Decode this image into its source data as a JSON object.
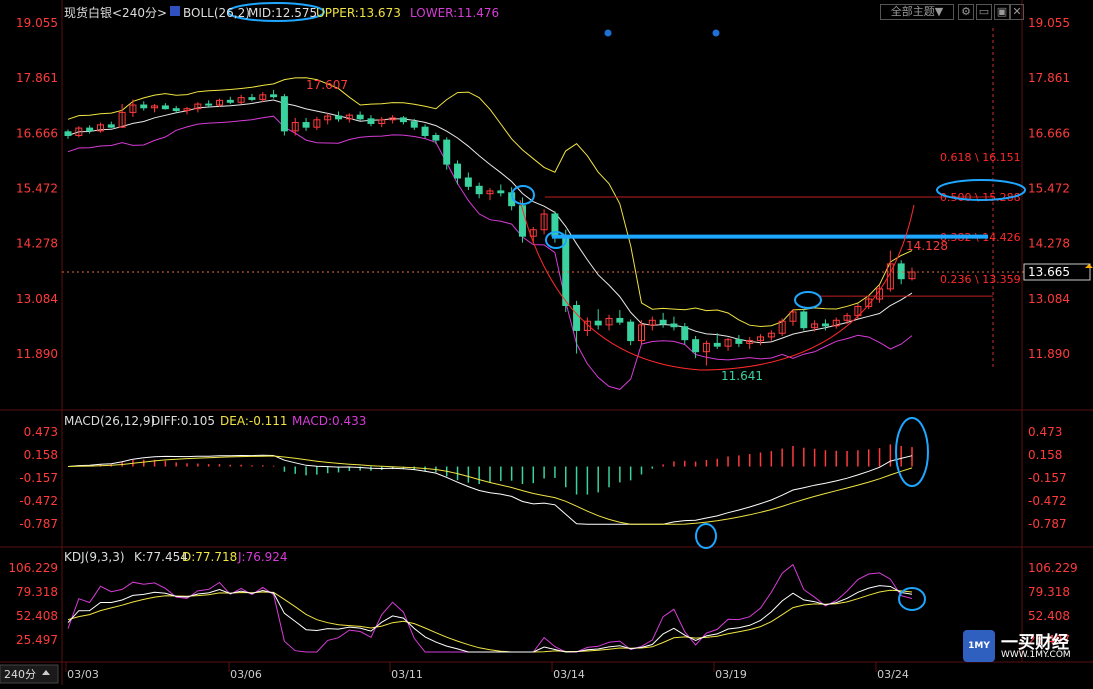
{
  "header": {
    "symbol": "现货白银",
    "period": "<240分>",
    "indicator": "BOLL(26,2)",
    "mid": "MID:12.575",
    "upper": "UPPER:13.673",
    "lower": "LOWER:11.476",
    "theme_button": "全部主题",
    "theme_arrow": "▼"
  },
  "colors": {
    "up": "#ff3b3b",
    "down": "#3ad29f",
    "mid": "#e8e8e8",
    "upper": "#f0e442",
    "lower": "#d63cd6",
    "grid_text": "#ff3b3b",
    "blue_mark": "#1ea7ff",
    "kdj_k": "#ffffff",
    "kdj_d": "#f0e442",
    "kdj_j": "#d63cd6"
  },
  "price_axis": [
    "19.055",
    "17.861",
    "16.666",
    "15.472",
    "14.278",
    "13.084",
    "11.890"
  ],
  "price_current": "13.665",
  "annotations": {
    "high": "17.607",
    "low": "11.641",
    "recent_high": "14.128"
  },
  "fibo": [
    {
      "label": "0.618 \\ 16.151",
      "value": 16.151
    },
    {
      "label": "0.500 \\ 15.288",
      "value": 15.288
    },
    {
      "label": "0.382 \\ 14.426",
      "value": 14.426
    },
    {
      "label": "0.236 \\ 13.359",
      "value": 13.359
    }
  ],
  "macd": {
    "title": "MACD(26,12,9)",
    "diff": "DIFF:0.105",
    "dea": "DEA:-0.111",
    "macd": "MACD:0.433",
    "axis": [
      "0.473",
      "0.158",
      "-0.157",
      "-0.472",
      "-0.787"
    ]
  },
  "kdj": {
    "title": "KDJ(9,3,3)",
    "k": "K:77.454",
    "d": "D:77.718",
    "j": "J:76.924",
    "axis": [
      "106.229",
      "79.318",
      "52.408",
      "25.497"
    ]
  },
  "time_axis": {
    "period_label": "240分",
    "dates": [
      "03/03",
      "03/06",
      "03/11",
      "03/14",
      "03/19",
      "03/24"
    ]
  },
  "logo": {
    "badge": "1MY",
    "name": "一买财经",
    "url": "WWW.1MY.COM"
  },
  "chart_data": {
    "type": "candlestick",
    "ylim": [
      11.2,
      19.4
    ],
    "candles": [
      [
        16.7,
        16.75,
        16.55,
        16.62
      ],
      [
        16.62,
        16.82,
        16.58,
        16.78
      ],
      [
        16.78,
        16.84,
        16.66,
        16.72
      ],
      [
        16.72,
        16.9,
        16.68,
        16.85
      ],
      [
        16.85,
        16.92,
        16.78,
        16.8
      ],
      [
        16.8,
        17.3,
        16.78,
        17.12
      ],
      [
        17.12,
        17.4,
        17.02,
        17.28
      ],
      [
        17.28,
        17.36,
        17.16,
        17.22
      ],
      [
        17.22,
        17.3,
        17.12,
        17.26
      ],
      [
        17.26,
        17.32,
        17.18,
        17.2
      ],
      [
        17.2,
        17.26,
        17.1,
        17.16
      ],
      [
        17.16,
        17.24,
        17.08,
        17.2
      ],
      [
        17.2,
        17.34,
        17.12,
        17.3
      ],
      [
        17.3,
        17.38,
        17.22,
        17.28
      ],
      [
        17.28,
        17.42,
        17.24,
        17.38
      ],
      [
        17.38,
        17.46,
        17.3,
        17.34
      ],
      [
        17.34,
        17.5,
        17.3,
        17.44
      ],
      [
        17.44,
        17.52,
        17.36,
        17.4
      ],
      [
        17.4,
        17.56,
        17.34,
        17.5
      ],
      [
        17.5,
        17.607,
        17.42,
        17.46
      ],
      [
        17.46,
        17.52,
        16.62,
        16.72
      ],
      [
        16.72,
        17.0,
        16.62,
        16.9
      ],
      [
        16.9,
        17.0,
        16.72,
        16.8
      ],
      [
        16.8,
        17.02,
        16.74,
        16.96
      ],
      [
        16.96,
        17.1,
        16.86,
        17.04
      ],
      [
        17.04,
        17.14,
        16.92,
        16.98
      ],
      [
        16.98,
        17.1,
        16.9,
        17.06
      ],
      [
        17.06,
        17.14,
        16.94,
        16.98
      ],
      [
        16.98,
        17.06,
        16.82,
        16.88
      ],
      [
        16.88,
        17.02,
        16.8,
        16.96
      ],
      [
        16.96,
        17.06,
        16.88,
        17.0
      ],
      [
        17.0,
        17.04,
        16.86,
        16.92
      ],
      [
        16.92,
        16.98,
        16.74,
        16.8
      ],
      [
        16.8,
        16.86,
        16.56,
        16.62
      ],
      [
        16.62,
        16.68,
        16.44,
        16.52
      ],
      [
        16.52,
        16.58,
        15.88,
        16.0
      ],
      [
        16.0,
        16.08,
        15.56,
        15.7
      ],
      [
        15.7,
        15.82,
        15.44,
        15.52
      ],
      [
        15.52,
        15.6,
        15.26,
        15.36
      ],
      [
        15.36,
        15.48,
        15.22,
        15.42
      ],
      [
        15.42,
        15.56,
        15.3,
        15.38
      ],
      [
        15.38,
        15.5,
        15.0,
        15.1
      ],
      [
        15.1,
        15.28,
        14.3,
        14.44
      ],
      [
        14.44,
        14.64,
        14.3,
        14.58
      ],
      [
        14.58,
        15.02,
        14.48,
        14.92
      ],
      [
        14.92,
        14.98,
        14.3,
        14.44
      ],
      [
        14.44,
        14.58,
        12.8,
        12.94
      ],
      [
        12.94,
        13.04,
        11.9,
        12.4
      ],
      [
        12.4,
        12.68,
        12.28,
        12.6
      ],
      [
        12.6,
        12.86,
        12.42,
        12.52
      ],
      [
        12.52,
        12.74,
        12.4,
        12.66
      ],
      [
        12.66,
        12.84,
        12.52,
        12.58
      ],
      [
        12.58,
        12.64,
        12.08,
        12.18
      ],
      [
        12.18,
        12.62,
        12.1,
        12.52
      ],
      [
        12.52,
        12.7,
        12.4,
        12.62
      ],
      [
        12.62,
        12.78,
        12.46,
        12.54
      ],
      [
        12.54,
        12.7,
        12.4,
        12.48
      ],
      [
        12.48,
        12.56,
        12.1,
        12.2
      ],
      [
        12.2,
        12.28,
        11.8,
        11.94
      ],
      [
        11.94,
        12.18,
        11.641,
        12.12
      ],
      [
        12.12,
        12.34,
        12.0,
        12.06
      ],
      [
        12.06,
        12.24,
        11.96,
        12.2
      ],
      [
        12.2,
        12.3,
        12.04,
        12.12
      ],
      [
        12.12,
        12.26,
        12.0,
        12.18
      ],
      [
        12.18,
        12.32,
        12.08,
        12.26
      ],
      [
        12.26,
        12.4,
        12.18,
        12.34
      ],
      [
        12.34,
        12.66,
        12.28,
        12.6
      ],
      [
        12.6,
        12.86,
        12.5,
        12.8
      ],
      [
        12.8,
        12.86,
        12.4,
        12.46
      ],
      [
        12.46,
        12.62,
        12.38,
        12.54
      ],
      [
        12.54,
        12.64,
        12.4,
        12.5
      ],
      [
        12.5,
        12.68,
        12.44,
        12.62
      ],
      [
        12.62,
        12.78,
        12.54,
        12.72
      ],
      [
        12.72,
        12.98,
        12.66,
        12.92
      ],
      [
        12.92,
        13.14,
        12.86,
        13.08
      ],
      [
        13.08,
        13.38,
        13.0,
        13.3
      ],
      [
        13.3,
        14.128,
        13.24,
        13.84
      ],
      [
        13.84,
        13.92,
        13.4,
        13.52
      ],
      [
        13.52,
        13.76,
        13.48,
        13.665
      ]
    ]
  }
}
